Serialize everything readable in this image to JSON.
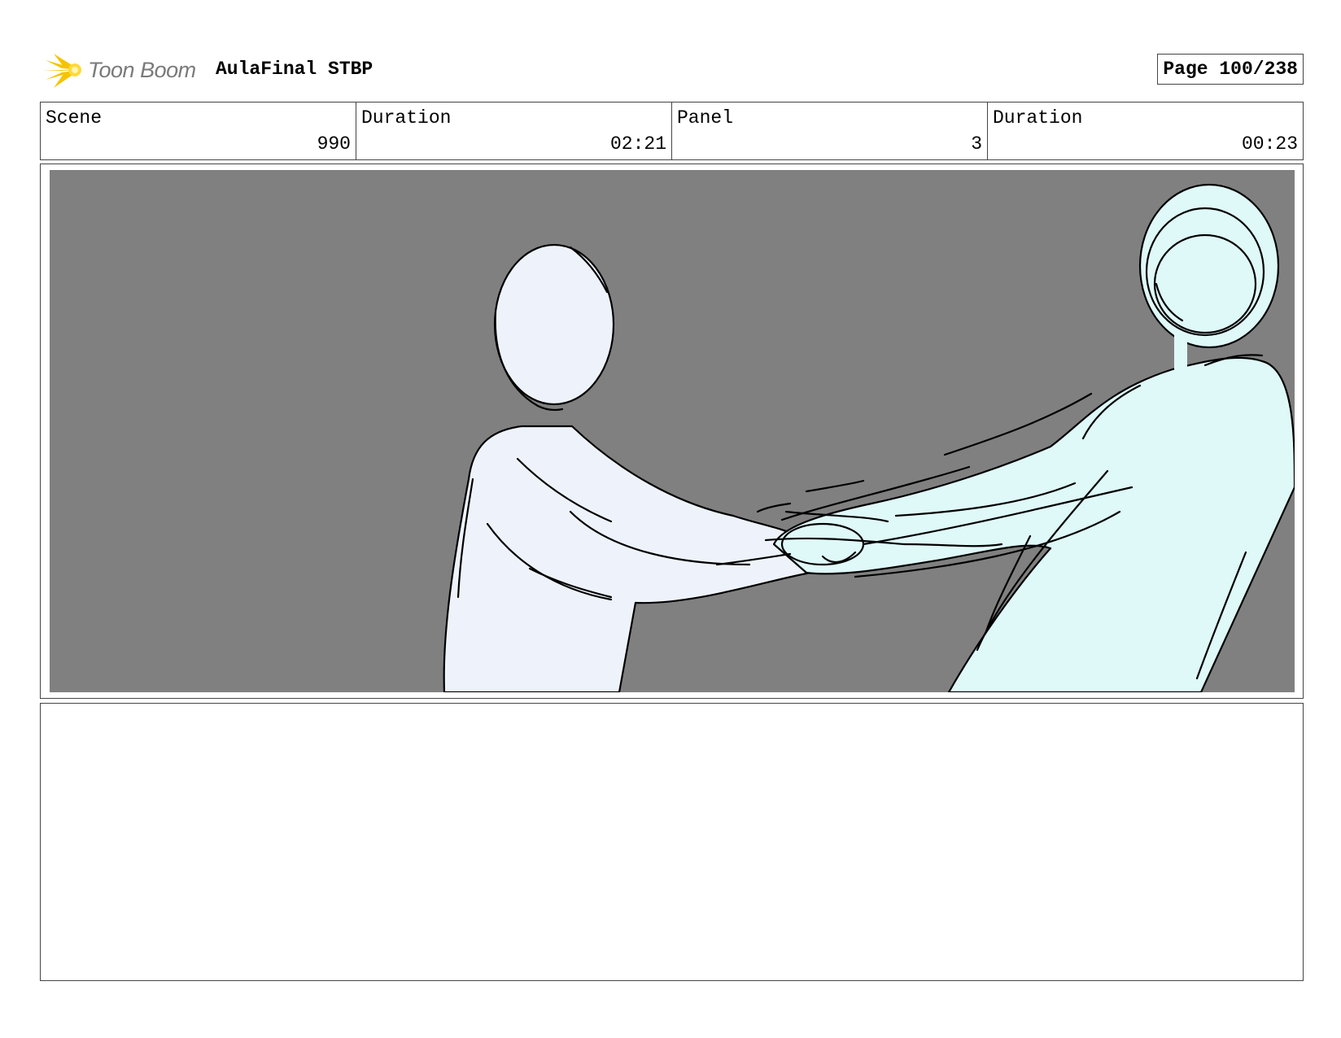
{
  "header": {
    "logo_text": "Toon Boom",
    "project_title": "AulaFinal STBP",
    "page_label": "Page 100/238"
  },
  "info": {
    "scene_label": "Scene",
    "scene_value": "990",
    "scene_duration_label": "Duration",
    "scene_duration_value": "02:21",
    "panel_label": "Panel",
    "panel_value": "3",
    "panel_duration_label": "Duration",
    "panel_duration_value": "00:23"
  },
  "colors": {
    "background_gray": "#808080",
    "left_figure_fill": "#eef3fb",
    "right_figure_fill": "#dff8f8",
    "logo_yellow": "#f5c400"
  }
}
